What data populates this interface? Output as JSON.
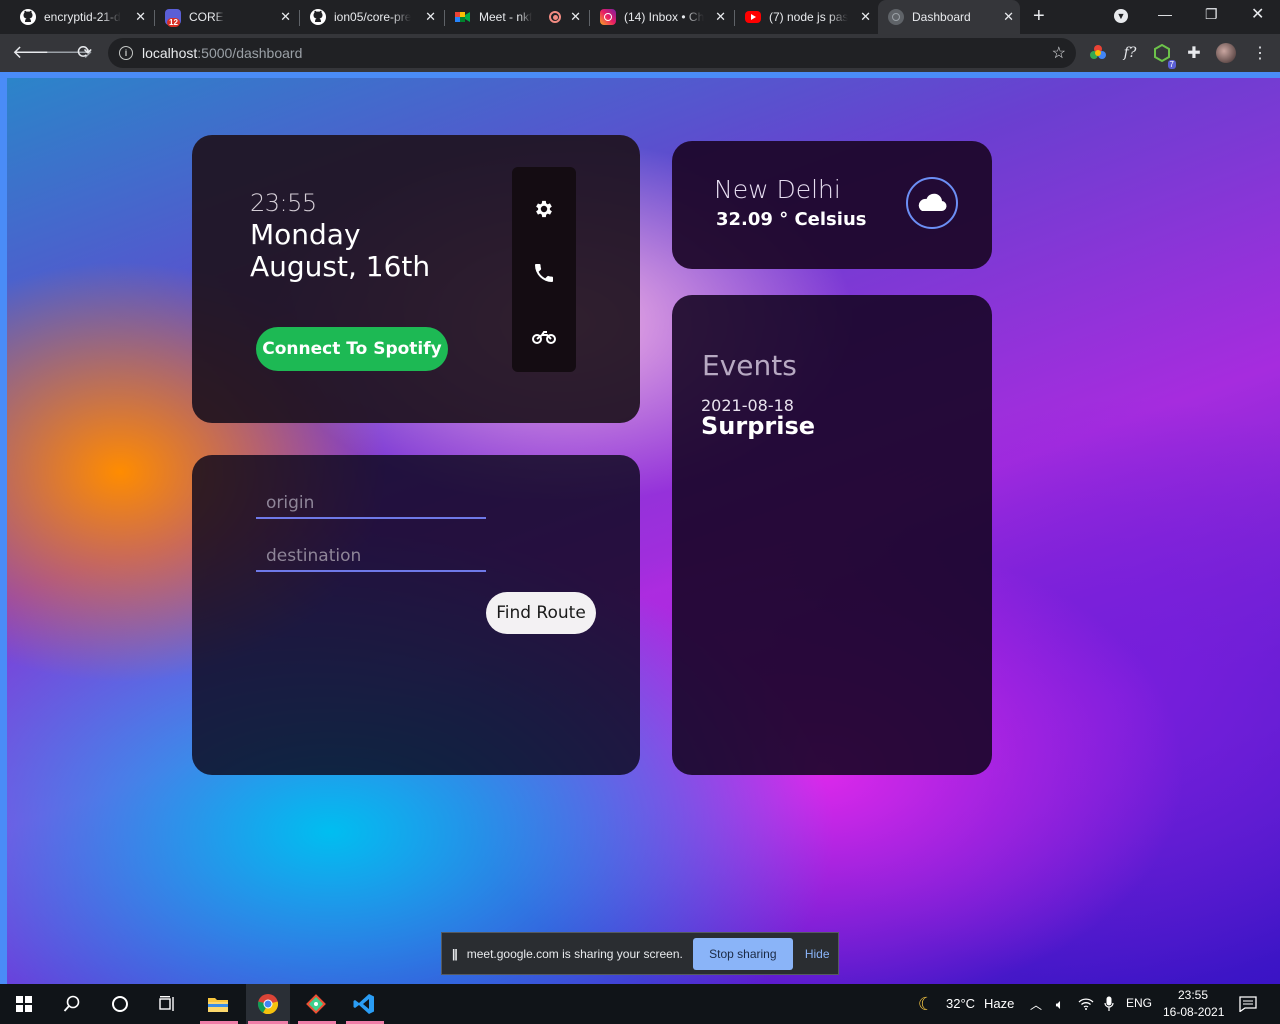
{
  "browser": {
    "tabs": [
      {
        "title": "encryptid-21-d",
        "icon": "github-icon",
        "active": false
      },
      {
        "title": "CORE",
        "icon": "core-badge-icon",
        "badge": "12",
        "active": false
      },
      {
        "title": "ion05/core-pre",
        "icon": "github-icon",
        "active": false
      },
      {
        "title": "Meet - nkf",
        "icon": "google-meet-icon",
        "active": false
      },
      {
        "title": "(14) Inbox • Ch",
        "icon": "instagram-icon",
        "active": false
      },
      {
        "title": "(7) node js pas",
        "icon": "youtube-icon",
        "active": false
      },
      {
        "title": "Dashboard",
        "icon": "globe-icon",
        "active": true
      }
    ],
    "url_host": "localhost",
    "url_path": ":5000/dashboard",
    "extension_badge": "7"
  },
  "colors": {
    "spotify_green": "#1db954",
    "input_underline": "#6f79e8",
    "share_accent": "#8ab4f8"
  },
  "clock": {
    "time": "23:55",
    "day": "Monday",
    "date": "August, 16th",
    "spotify_label": "Connect To Spotify",
    "menu_icons": [
      "gear-icon",
      "phone-icon",
      "motorcycle-icon"
    ]
  },
  "weather": {
    "city": "New Delhi",
    "temperature": "32.09 ° Celsius",
    "icon": "cloud-icon"
  },
  "events": {
    "title": "Events",
    "items": [
      {
        "date": "2021-08-18",
        "name": "Surprise"
      }
    ]
  },
  "route": {
    "origin_placeholder": "origin",
    "destination_placeholder": "destination",
    "button_label": "Find Route"
  },
  "share_bar": {
    "message": "meet.google.com is sharing your screen.",
    "stop_label": "Stop sharing",
    "hide_label": "Hide"
  },
  "taskbar": {
    "weather": "32°C",
    "weather_desc": "Haze",
    "language": "ENG",
    "time": "23:55",
    "date": "16-08-2021"
  }
}
